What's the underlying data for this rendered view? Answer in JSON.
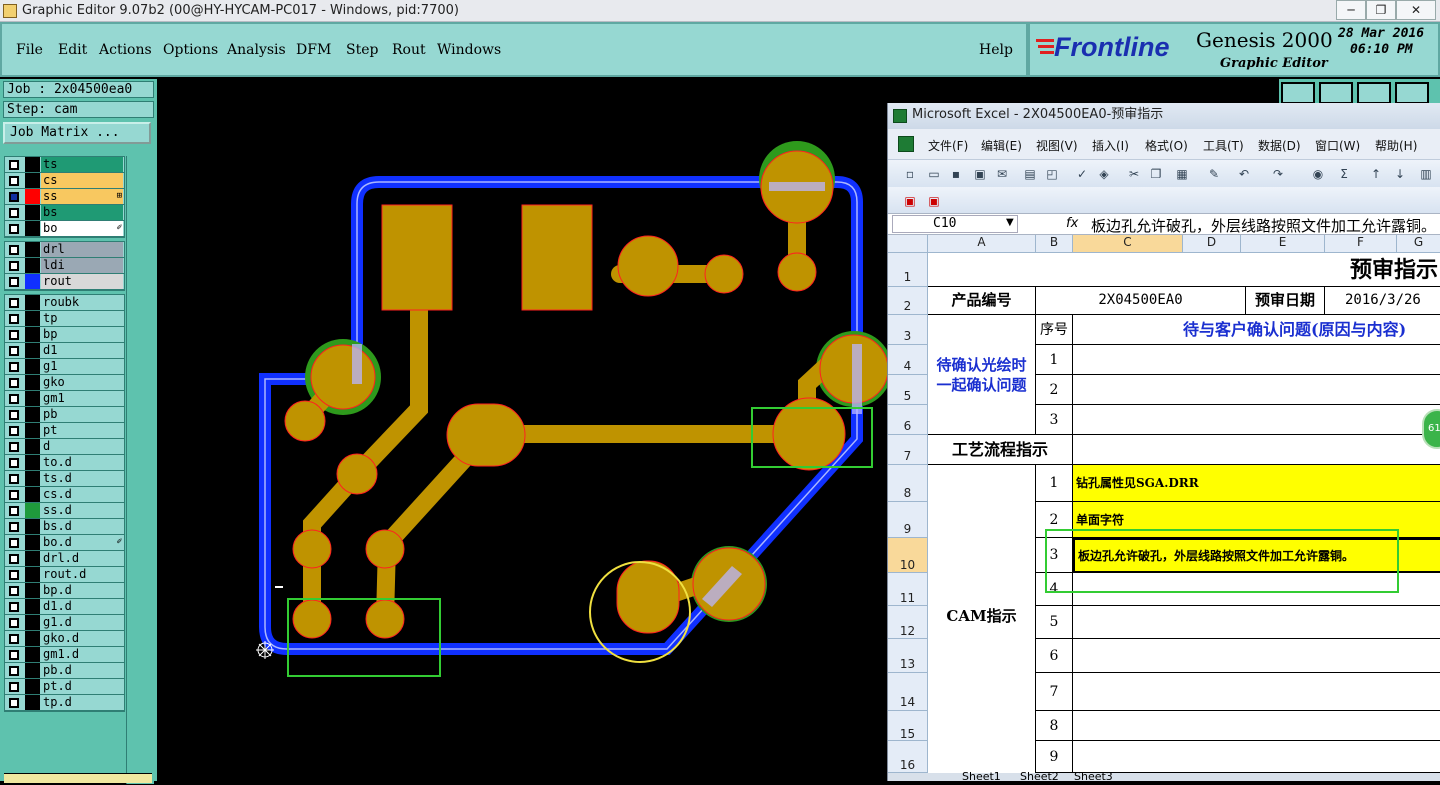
{
  "titlebar": {
    "title": "Graphic Editor 9.07b2 (00@HY-HYCAM-PC017 - Windows, pid:7700)",
    "min": "─",
    "max": "❐",
    "close": "✕"
  },
  "menu": [
    {
      "label": "File"
    },
    {
      "label": "Edit"
    },
    {
      "label": "Actions"
    },
    {
      "label": "Options"
    },
    {
      "label": "Analysis"
    },
    {
      "label": "DFM"
    },
    {
      "label": "Step"
    },
    {
      "label": "Rout"
    },
    {
      "label": "Windows"
    }
  ],
  "help": "Help",
  "brand": {
    "logo": "Frontline",
    "product": "Genesis 2000",
    "subtitle": "Graphic Editor",
    "date": "28 Mar 2016",
    "time": "06:10 PM"
  },
  "job": {
    "job_label": "Job : 2x04500ea0",
    "step_label": "Step: cam",
    "matrix_button": "Job Matrix ..."
  },
  "layer_groups": [
    [
      {
        "name": "ts",
        "color": "#1f9a74",
        "swatch": "#000",
        "mark": ""
      },
      {
        "name": "cs",
        "color": "#f8c860",
        "swatch": "#000",
        "mark": ""
      },
      {
        "name": "ss",
        "color": "#f8c860",
        "swatch": "#ff0000",
        "mark": "⊞",
        "checked": true
      },
      {
        "name": "bs",
        "color": "#1f9a74",
        "swatch": "#000",
        "mark": ""
      },
      {
        "name": "bo",
        "color": "#ffffff",
        "swatch": "#000",
        "mark": "✐"
      }
    ],
    [
      {
        "name": "drl",
        "color": "#9aa8b4",
        "swatch": "#000",
        "mark": ""
      },
      {
        "name": "ldi",
        "color": "#9aa8b4",
        "swatch": "#000",
        "mark": ""
      },
      {
        "name": "rout",
        "color": "#d8d8d8",
        "swatch": "#1030ff",
        "mark": ""
      }
    ],
    [
      {
        "name": "roubk",
        "color": "#96d8d2",
        "swatch": "#000",
        "mark": ""
      },
      {
        "name": "tp",
        "color": "#96d8d2",
        "swatch": "#000",
        "mark": ""
      },
      {
        "name": "bp",
        "color": "#96d8d2",
        "swatch": "#000",
        "mark": ""
      },
      {
        "name": "d1",
        "color": "#96d8d2",
        "swatch": "#000",
        "mark": ""
      },
      {
        "name": "g1",
        "color": "#96d8d2",
        "swatch": "#000",
        "mark": ""
      },
      {
        "name": "gko",
        "color": "#96d8d2",
        "swatch": "#000",
        "mark": ""
      },
      {
        "name": "gm1",
        "color": "#96d8d2",
        "swatch": "#000",
        "mark": ""
      },
      {
        "name": "pb",
        "color": "#96d8d2",
        "swatch": "#000",
        "mark": ""
      },
      {
        "name": "pt",
        "color": "#96d8d2",
        "swatch": "#000",
        "mark": ""
      },
      {
        "name": "d",
        "color": "#96d8d2",
        "swatch": "#000",
        "mark": ""
      },
      {
        "name": "to.d",
        "color": "#96d8d2",
        "swatch": "#000",
        "mark": ""
      },
      {
        "name": "ts.d",
        "color": "#96d8d2",
        "swatch": "#000",
        "mark": ""
      },
      {
        "name": "cs.d",
        "color": "#96d8d2",
        "swatch": "#000",
        "mark": ""
      },
      {
        "name": "ss.d",
        "color": "#96d8d2",
        "swatch": "#1f9a3c",
        "mark": ""
      },
      {
        "name": "bs.d",
        "color": "#96d8d2",
        "swatch": "#000",
        "mark": ""
      },
      {
        "name": "bo.d",
        "color": "#96d8d2",
        "swatch": "#000",
        "mark": "✐"
      },
      {
        "name": "drl.d",
        "color": "#96d8d2",
        "swatch": "#000",
        "mark": ""
      },
      {
        "name": "rout.d",
        "color": "#96d8d2",
        "swatch": "#000",
        "mark": ""
      },
      {
        "name": "bp.d",
        "color": "#96d8d2",
        "swatch": "#000",
        "mark": ""
      },
      {
        "name": "d1.d",
        "color": "#96d8d2",
        "swatch": "#000",
        "mark": ""
      },
      {
        "name": "g1.d",
        "color": "#96d8d2",
        "swatch": "#000",
        "mark": ""
      },
      {
        "name": "gko.d",
        "color": "#96d8d2",
        "swatch": "#000",
        "mark": ""
      },
      {
        "name": "gm1.d",
        "color": "#96d8d2",
        "swatch": "#000",
        "mark": ""
      },
      {
        "name": "pb.d",
        "color": "#96d8d2",
        "swatch": "#000",
        "mark": ""
      },
      {
        "name": "pt.d",
        "color": "#96d8d2",
        "swatch": "#000",
        "mark": ""
      },
      {
        "name": "tp.d",
        "color": "#96d8d2",
        "swatch": "#000",
        "mark": ""
      }
    ]
  ],
  "colors": {
    "copper": "#bf9300",
    "rout": "#1030ff",
    "soldermask": "#2e9a1c",
    "highlight": "#33cc33",
    "select": "#f0e040"
  },
  "excel": {
    "title": "Microsoft Excel - 2X04500EA0-预审指示",
    "menu": [
      "文件(F)",
      "编辑(E)",
      "视图(V)",
      "插入(I)",
      "格式(O)",
      "工具(T)",
      "数据(D)",
      "窗口(W)",
      "帮助(H)"
    ],
    "namebox": "C10",
    "fx": "fx",
    "formula": "板边孔允许破孔，外层线路按照文件加工允许露铜。",
    "columns": [
      "A",
      "B",
      "C",
      "D",
      "E",
      "F",
      "G"
    ],
    "rows": [
      "1",
      "2",
      "3",
      "4",
      "5",
      "6",
      "7",
      "8",
      "9",
      "10",
      "11",
      "12",
      "13",
      "14",
      "15",
      "16"
    ],
    "sheet_title": "预审指示",
    "product_no_label": "产品编号",
    "product_no": "2X04500EA0",
    "review_date_label": "预审日期",
    "review_date": "2016/3/26",
    "confirm_label": "待确认光绘时一起确认问题",
    "seq_label": "序号",
    "issue_header": "待与客户确认问题(原因与内容)",
    "seq": [
      "1",
      "2",
      "3"
    ],
    "process_label": "工艺流程指示",
    "cam_label": "CAM指示",
    "cam_seq": [
      "1",
      "2",
      "3",
      "4",
      "5",
      "6",
      "7",
      "8",
      "9"
    ],
    "cam_items": [
      "钻孔属性见SGA.DRR",
      "单面字符",
      "板边孔允许破孔，外层线路按照文件加工允许露铜。"
    ],
    "sheet_tabs": [
      "Sheet1",
      "Sheet2",
      "Sheet3"
    ]
  }
}
